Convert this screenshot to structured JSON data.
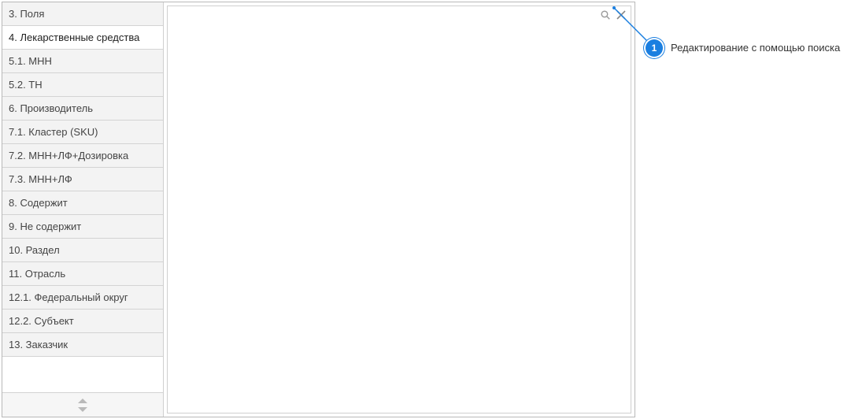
{
  "sidebar": {
    "items": [
      {
        "label": "3. Поля",
        "active": false
      },
      {
        "label": "4. Лекарственные средства",
        "active": true
      },
      {
        "label": "5.1. МНН",
        "active": false
      },
      {
        "label": "5.2. ТН",
        "active": false
      },
      {
        "label": "6. Производитель",
        "active": false
      },
      {
        "label": "7.1. Кластер (SKU)",
        "active": false
      },
      {
        "label": "7.2. МНН+ЛФ+Дозировка",
        "active": false
      },
      {
        "label": "7.3. МНН+ЛФ",
        "active": false
      },
      {
        "label": "8. Содержит",
        "active": false
      },
      {
        "label": "9. Не содержит",
        "active": false
      },
      {
        "label": "10. Раздел",
        "active": false
      },
      {
        "label": "11. Отрасль",
        "active": false
      },
      {
        "label": "12.1. Федеральный округ",
        "active": false
      },
      {
        "label": "12.2. Субъект",
        "active": false
      },
      {
        "label": "13. Заказчик",
        "active": false
      }
    ]
  },
  "toolbar": {
    "search_label": "search",
    "close_label": "close"
  },
  "callouts": [
    {
      "number": "1",
      "text": "Редактирование с помощью поиска"
    }
  ],
  "colors": {
    "accent": "#1b7fe0",
    "border": "#cfcfcf"
  }
}
